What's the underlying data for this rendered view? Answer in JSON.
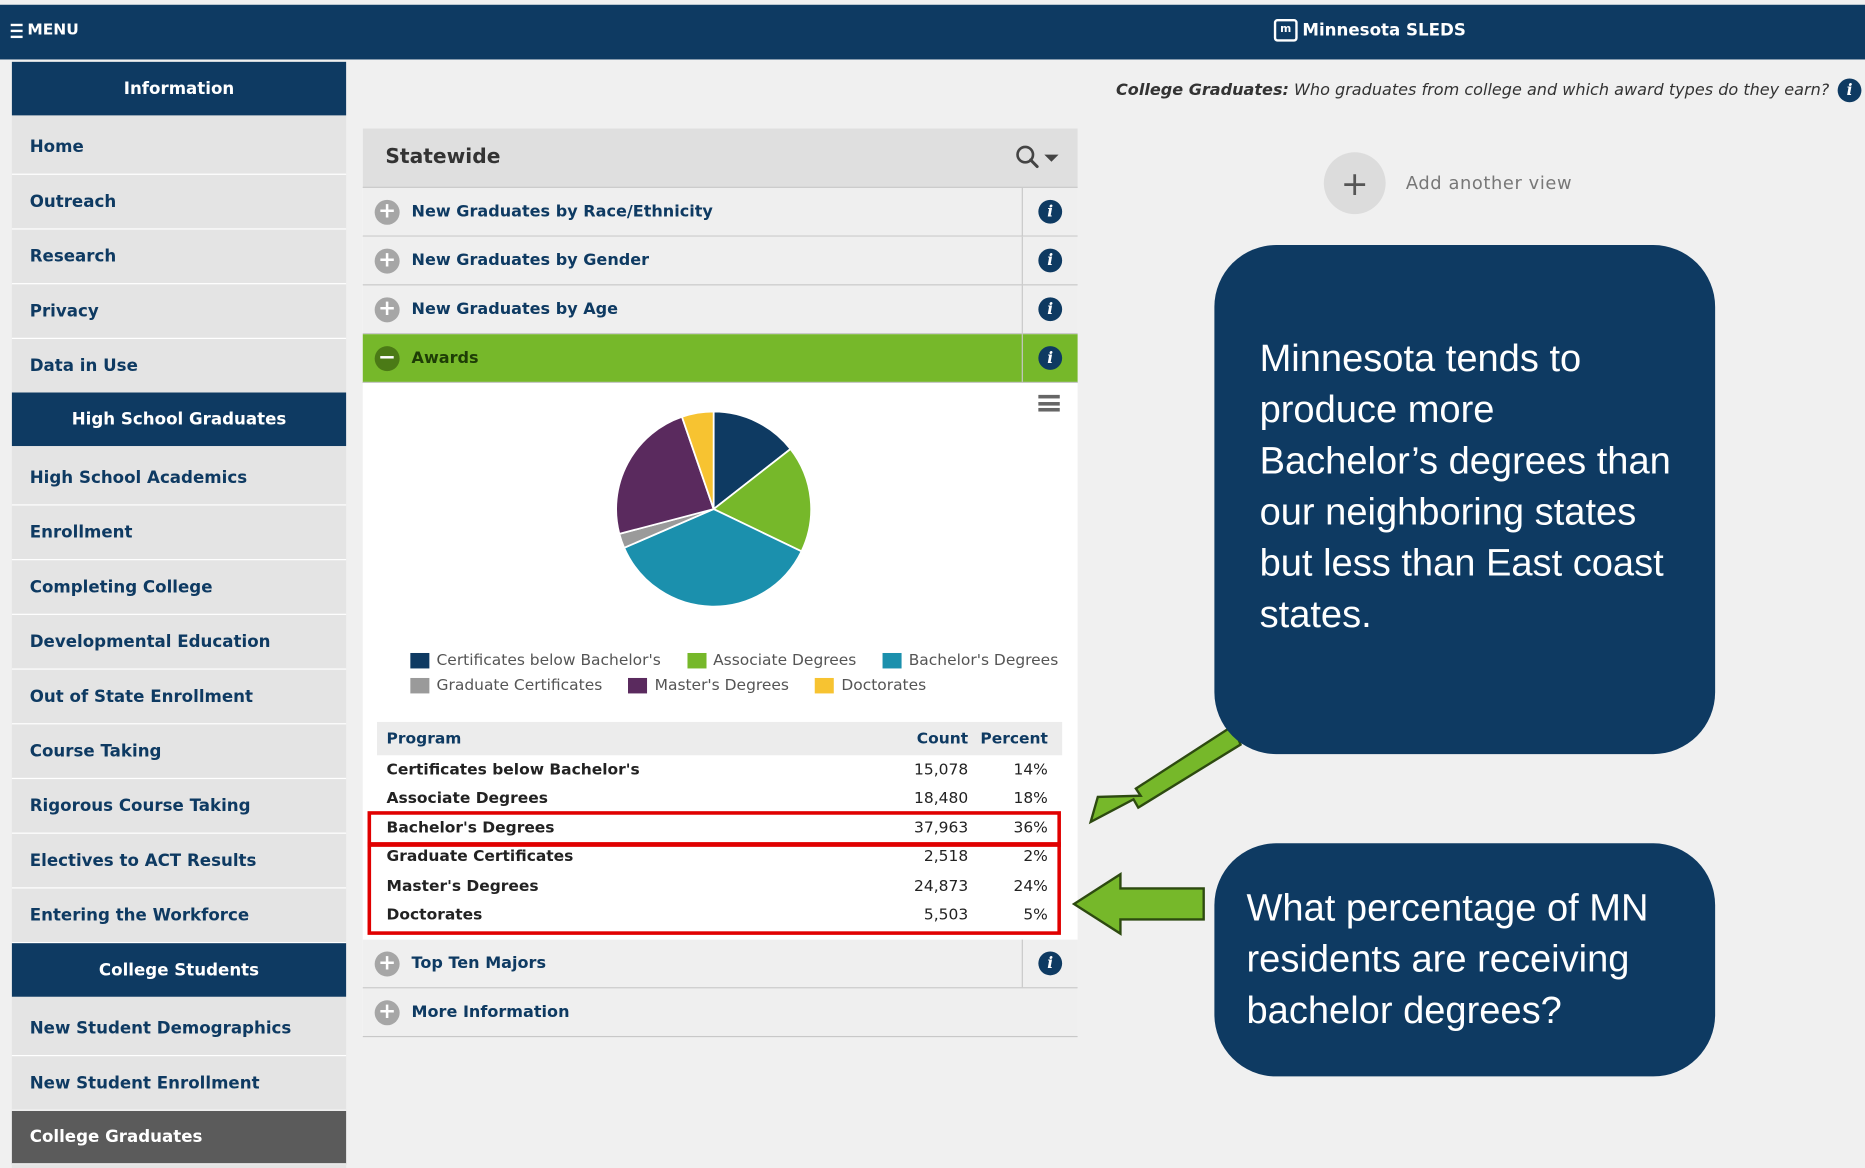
{
  "topbar": {
    "menu_label": "MENU",
    "brand_logo": "m",
    "brand_name": "Minnesota SLEDS"
  },
  "sidebar": {
    "sections": [
      {
        "title": "Information"
      },
      {
        "title": "High School Graduates"
      },
      {
        "title": "College Students"
      }
    ],
    "items": [
      {
        "label": "Home"
      },
      {
        "label": "Outreach"
      },
      {
        "label": "Research"
      },
      {
        "label": "Privacy"
      },
      {
        "label": "Data in Use"
      },
      {
        "label": "High School Academics"
      },
      {
        "label": "Enrollment"
      },
      {
        "label": "Completing College"
      },
      {
        "label": "Developmental Education"
      },
      {
        "label": "Out of State Enrollment"
      },
      {
        "label": "Course Taking"
      },
      {
        "label": "Rigorous Course Taking"
      },
      {
        "label": "Electives to ACT Results"
      },
      {
        "label": "Entering the Workforce"
      },
      {
        "label": "New Student Demographics"
      },
      {
        "label": "New Student Enrollment"
      },
      {
        "label": "College Graduates"
      }
    ]
  },
  "prompt": {
    "bold": "College Graduates:",
    "text": " Who graduates from college and which award types do they earn?"
  },
  "add_view": {
    "label": "Add another view",
    "icon": "+"
  },
  "panel": {
    "title": "Statewide",
    "sections": [
      {
        "label": "New Graduates by Race/Ethnicity",
        "toggle": "+"
      },
      {
        "label": "New Graduates by Gender",
        "toggle": "+"
      },
      {
        "label": "New Graduates by Age",
        "toggle": "+"
      },
      {
        "label": "Awards",
        "toggle": "−"
      },
      {
        "label": "Top Ten Majors",
        "toggle": "+"
      },
      {
        "label": "More Information",
        "toggle": "+"
      }
    ],
    "info_glyph": "i"
  },
  "table": {
    "headers": [
      "Program",
      "Count",
      "Percent"
    ],
    "rows": [
      {
        "program": "Certificates below Bachelor's",
        "count": "15,078",
        "percent": "14%"
      },
      {
        "program": "Associate Degrees",
        "count": "18,480",
        "percent": "18%"
      },
      {
        "program": "Bachelor's Degrees",
        "count": "37,963",
        "percent": "36%"
      },
      {
        "program": "Graduate Certificates",
        "count": "2,518",
        "percent": "2%"
      },
      {
        "program": "Master's Degrees",
        "count": "24,873",
        "percent": "24%"
      },
      {
        "program": "Doctorates",
        "count": "5,503",
        "percent": "5%"
      }
    ]
  },
  "chart_data": {
    "type": "pie",
    "categories": [
      "Certificates below Bachelor's",
      "Associate Degrees",
      "Bachelor's Degrees",
      "Graduate Certificates",
      "Master's Degrees",
      "Doctorates"
    ],
    "values": [
      15078,
      18480,
      37963,
      2518,
      24873,
      5503
    ],
    "colors": [
      "#0e3a62",
      "#76b82a",
      "#1b90ad",
      "#9a9a9a",
      "#5a2a5e",
      "#f7c331"
    ],
    "legend": "bottom"
  },
  "callouts": {
    "first": "Minnesota tends to produce more Bachelor’s degrees than our neighboring states but less than East coast states.",
    "second": "What percentage of MN residents are receiving bachelor degrees?"
  },
  "colors": {
    "navy": "#0e3a62",
    "green": "#76b82a",
    "highlight": "#e00000"
  }
}
